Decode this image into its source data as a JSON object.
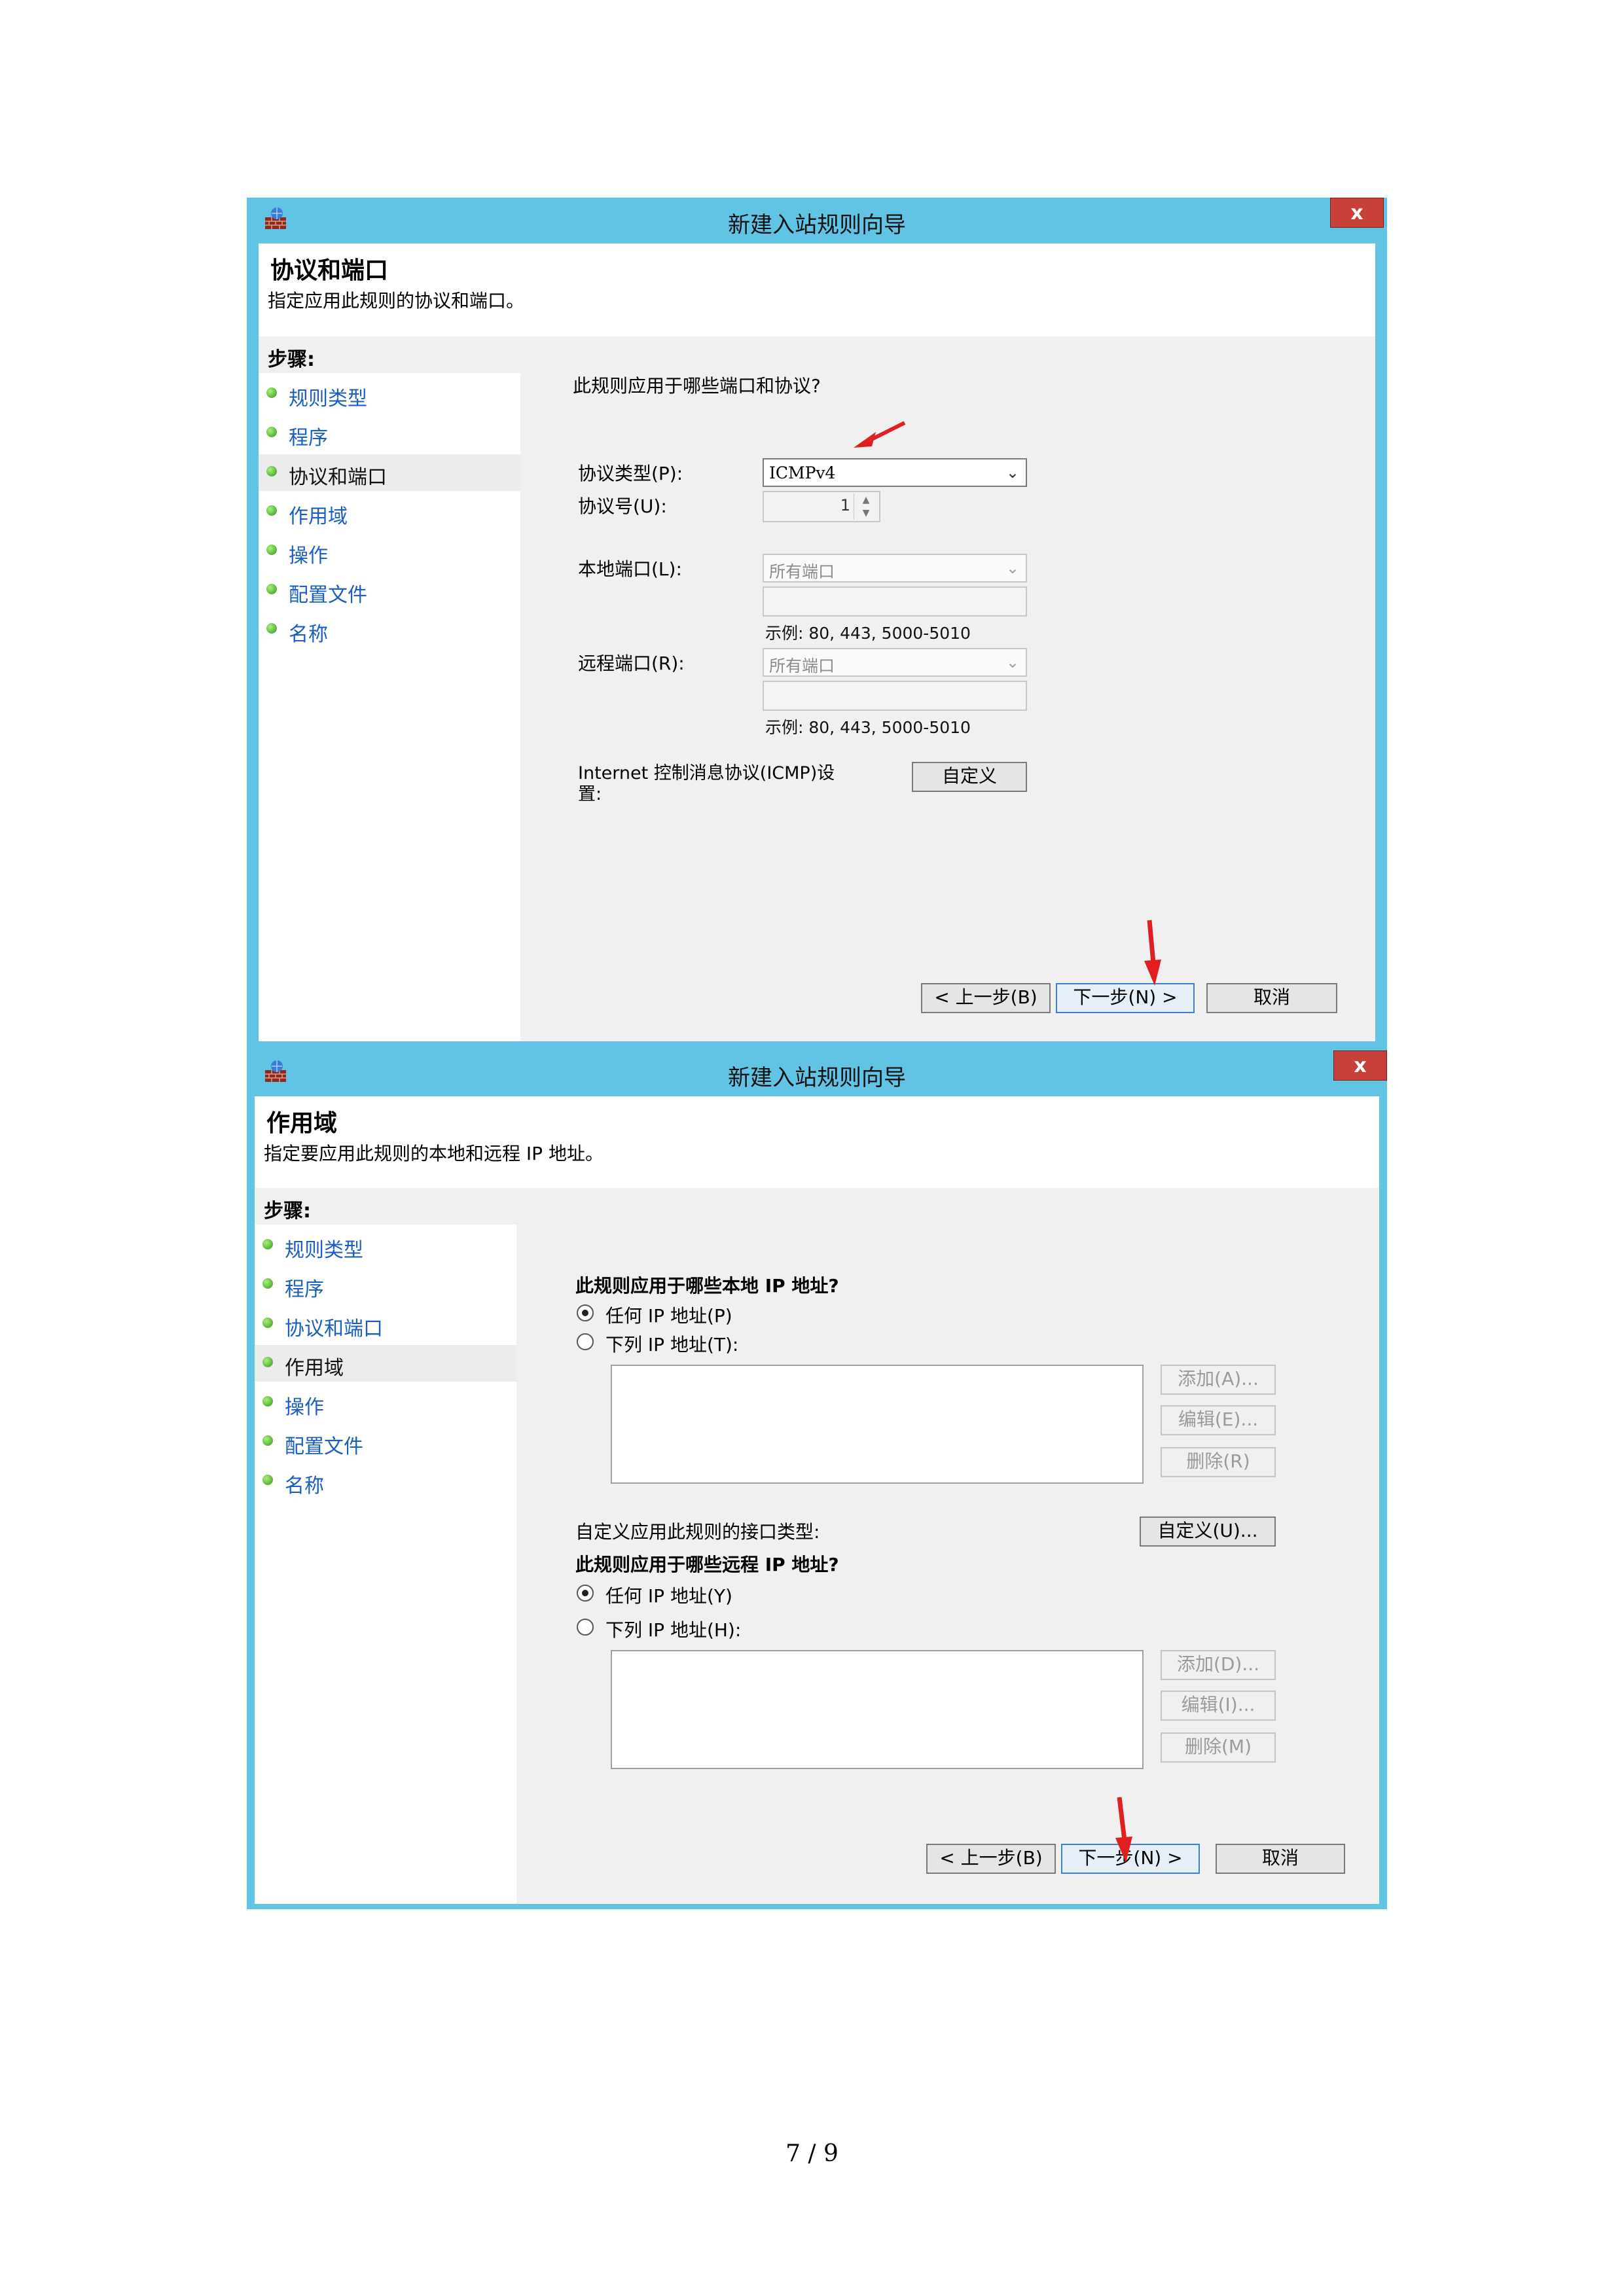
{
  "page_number": "7 / 9",
  "colors": {
    "title_bar": "#62c4e4",
    "close_button": "#c7403a",
    "step_dot": "#3aa52a",
    "arrow": "#e02020"
  },
  "dialog1": {
    "title": "新建入站规则向导",
    "close_label": "x",
    "header_title": "协议和端口",
    "header_subtitle": "指定应用此规则的协议和端口。",
    "steps_heading": "步骤:",
    "steps": [
      "规则类型",
      "程序",
      "协议和端口",
      "作用域",
      "操作",
      "配置文件",
      "名称"
    ],
    "question": "此规则应用于哪些端口和协议?",
    "protocol_type_label": "协议类型(P):",
    "protocol_type_value": "ICMPv4",
    "protocol_number_label": "协议号(U):",
    "protocol_number_value": "1",
    "local_port_label": "本地端口(L):",
    "local_port_value": "所有端口",
    "local_port_example": "示例: 80, 443, 5000-5010",
    "remote_port_label": "远程端口(R):",
    "remote_port_value": "所有端口",
    "remote_port_example": "示例: 80, 443, 5000-5010",
    "icmp_label_line1": "Internet 控制消息协议(ICMP)设",
    "icmp_label_line2": "置:",
    "customize_label": "自定义",
    "back_label": "< 上一步(B)",
    "next_label": "下一步(N) >",
    "cancel_label": "取消"
  },
  "dialog2": {
    "title": "新建入站规则向导",
    "close_label": "x",
    "header_title": "作用域",
    "header_subtitle": "指定要应用此规则的本地和远程 IP 地址。",
    "steps_heading": "步骤:",
    "steps": [
      "规则类型",
      "程序",
      "协议和端口",
      "作用域",
      "操作",
      "配置文件",
      "名称"
    ],
    "local_question": "此规则应用于哪些本地 IP 地址?",
    "local_any": "任何 IP 地址(P)",
    "local_these": "下列 IP 地址(T):",
    "local_add": "添加(A)...",
    "local_edit": "编辑(E)...",
    "local_remove": "删除(R)",
    "interface_label": "自定义应用此规则的接口类型:",
    "interface_customize": "自定义(U)...",
    "remote_question": "此规则应用于哪些远程 IP 地址?",
    "remote_any": "任何 IP 地址(Y)",
    "remote_these": "下列 IP 地址(H):",
    "remote_add": "添加(D)...",
    "remote_edit": "编辑(I)...",
    "remote_remove": "删除(M)",
    "back_label": "< 上一步(B)",
    "next_label": "下一步(N) >",
    "cancel_label": "取消"
  }
}
